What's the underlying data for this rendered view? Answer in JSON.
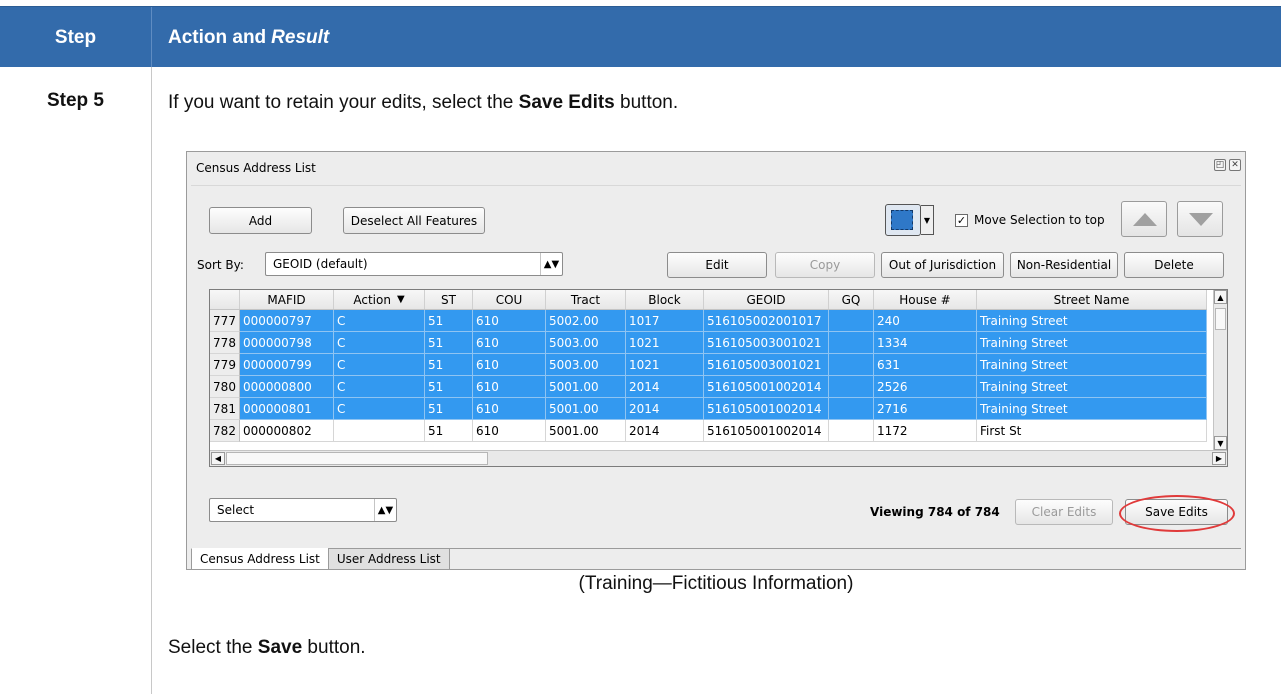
{
  "table_header": {
    "col1": "Step",
    "col2_a": "Action and",
    "col2_b": "Result"
  },
  "step_label": "Step 5",
  "instruction_1": {
    "pre": "If you want to retain your edits, select the ",
    "bold": "Save Edits",
    "post": " button."
  },
  "caption": "(Training—Fictitious Information)",
  "instruction_2": {
    "pre": "Select the ",
    "bold": "Save",
    "post": " button."
  },
  "window": {
    "title": "Census Address List",
    "title_icons": [
      "restore-icon",
      "close-icon"
    ],
    "add_label": "Add",
    "deselect_label": "Deselect All Features",
    "select_tool_icon": "select-features-icon",
    "move_selection_label": "Move Selection to top",
    "move_selection_checked": true,
    "sort_by_label": "Sort By:",
    "sort_by_value": "GEOID (default)",
    "edit_label": "Edit",
    "copy_label": "Copy",
    "ooj_label": "Out of Jurisdiction",
    "nonres_label": "Non-Residential",
    "delete_label": "Delete",
    "select_combo_value": "Select",
    "viewing_text": "Viewing 784 of 784",
    "clear_edits_label": "Clear Edits",
    "save_edits_label": "Save Edits",
    "tabs": [
      "Census Address List",
      "User Address List"
    ],
    "colors": {
      "selection": "#3399f0",
      "header_bg": "#336bab",
      "highlight_ring": "#e03a3a"
    }
  },
  "grid": {
    "columns": [
      "",
      "MAFID",
      "Action",
      "ST",
      "COU",
      "Tract",
      "Block",
      "GEOID",
      "GQ",
      "House #",
      "Street Name"
    ],
    "rows": [
      {
        "rn": "777",
        "selected": true,
        "cells": [
          "000000797",
          "C",
          "51",
          "610",
          "5002.00",
          "1017",
          "516105002001017",
          "",
          "240",
          "Training Street"
        ]
      },
      {
        "rn": "778",
        "selected": true,
        "cells": [
          "000000798",
          "C",
          "51",
          "610",
          "5003.00",
          "1021",
          "516105003001021",
          "",
          "1334",
          "Training Street"
        ]
      },
      {
        "rn": "779",
        "selected": true,
        "cells": [
          "000000799",
          "C",
          "51",
          "610",
          "5003.00",
          "1021",
          "516105003001021",
          "",
          "631",
          "Training Street"
        ]
      },
      {
        "rn": "780",
        "selected": true,
        "cells": [
          "000000800",
          "C",
          "51",
          "610",
          "5001.00",
          "2014",
          "516105001002014",
          "",
          "2526",
          "Training Street"
        ]
      },
      {
        "rn": "781",
        "selected": true,
        "cells": [
          "000000801",
          "C",
          "51",
          "610",
          "5001.00",
          "2014",
          "516105001002014",
          "",
          "2716",
          "Training Street"
        ]
      },
      {
        "rn": "782",
        "selected": false,
        "cells": [
          "000000802",
          "",
          "51",
          "610",
          "5001.00",
          "2014",
          "516105001002014",
          "",
          "1172",
          "First St"
        ]
      }
    ]
  }
}
